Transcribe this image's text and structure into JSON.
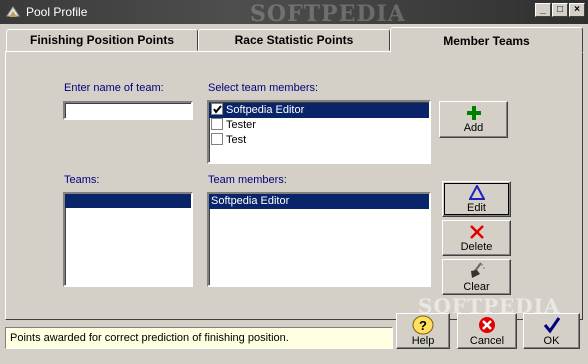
{
  "window": {
    "title": "Pool Profile",
    "watermark": "SOFTPEDIA",
    "minimize": "_",
    "maximize": "□",
    "close": "×"
  },
  "tabs": [
    {
      "label": "Finishing Position Points",
      "active": false
    },
    {
      "label": "Race Statistic Points",
      "active": false
    },
    {
      "label": "Member Teams",
      "active": true
    }
  ],
  "team_name": {
    "label": "Enter name of team:",
    "value": ""
  },
  "select_members": {
    "label": "Select team members:",
    "items": [
      {
        "label": "Softpedia Editor",
        "checked": true,
        "selected": true
      },
      {
        "label": "Tester",
        "checked": false,
        "selected": false
      },
      {
        "label": "Test",
        "checked": false,
        "selected": false
      }
    ]
  },
  "teams": {
    "label": "Teams:",
    "items": [
      ""
    ]
  },
  "team_members": {
    "label": "Team members:",
    "items": [
      "Softpedia Editor"
    ]
  },
  "buttons": {
    "add": "Add",
    "edit": "Edit",
    "delete": "Delete",
    "clear": "Clear",
    "help": "Help",
    "cancel": "Cancel",
    "ok": "OK"
  },
  "status_text": "Points awarded for correct prediction of finishing position.",
  "footer_watermark": "SOFTPEDIA",
  "colors": {
    "label": "#00007b",
    "selection": "#0a246a",
    "add_icon": "#008000",
    "delete_icon": "#e00000",
    "edit_icon": "#2020c0",
    "ok_icon": "#000080"
  }
}
